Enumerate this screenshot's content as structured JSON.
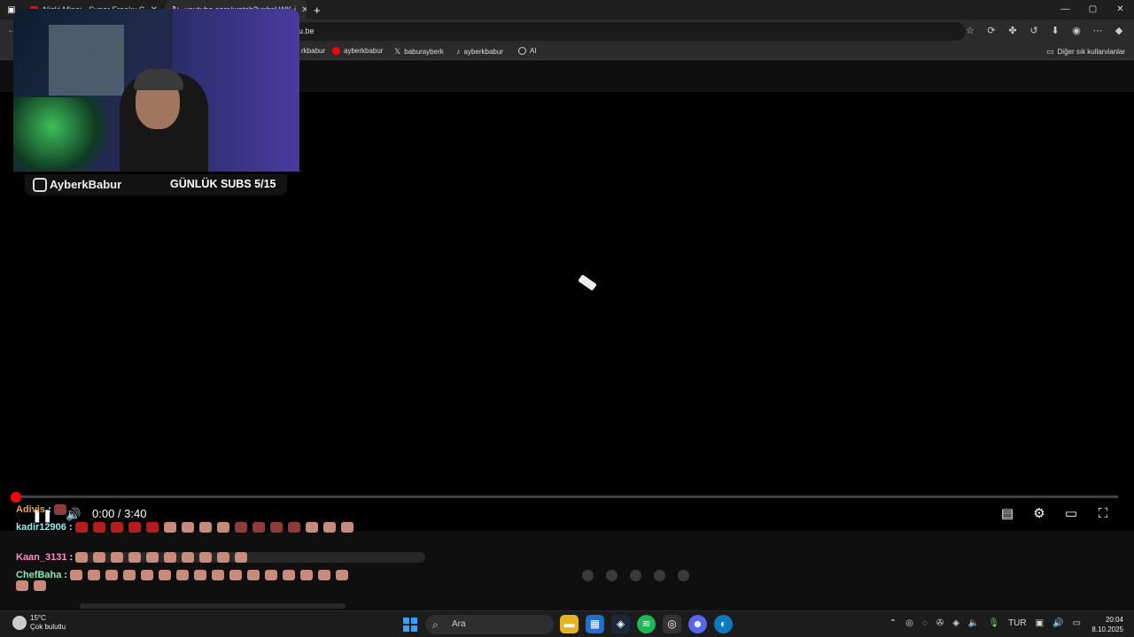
{
  "browser": {
    "tabs": [
      {
        "title": "Nicki Minaj - Super Freaky G",
        "active": false
      },
      {
        "title": "youtube.com/watch?v=bsLWK-i",
        "active": true
      }
    ],
    "new_tab_label": "+",
    "url": "u.be",
    "window_controls": [
      "—",
      "▢",
      "✕"
    ]
  },
  "bookmarks": [
    {
      "label": "rkbabur",
      "icon": "bookmark-icon"
    },
    {
      "label": "ayberkbabur",
      "icon": "youtube-icon"
    },
    {
      "label": "baburayberk",
      "icon": "x-icon"
    },
    {
      "label": "ayberkbabur",
      "icon": "tiktok-icon"
    },
    {
      "label": "AI",
      "icon": "ai-icon"
    }
  ],
  "other_bookmarks": "Diğer sık kullanılanlar",
  "player": {
    "current_time": "0:00",
    "duration": "3:40",
    "time_display": "0:00 / 3:40",
    "progress": 0
  },
  "stream_overlay": {
    "handle": "AyberkBabur",
    "subs_text": "GÜNLÜK SUBS 5/15"
  },
  "chat": [
    {
      "user": "Adivis",
      "color": "#e8a34a",
      "emotes": [
        "hat"
      ]
    },
    {
      "user": "kadir12906",
      "color": "#8ff0f0",
      "emotes": [
        "red",
        "red",
        "red",
        "red",
        "red",
        "pop",
        "pop",
        "pop",
        "pop",
        "hat",
        "hat",
        "hat",
        "hat",
        "pop",
        "pop",
        "pop"
      ]
    },
    {
      "user": "Kaan_3131",
      "color": "#ff8ec2",
      "emotes": [
        "pop",
        "pop",
        "pop",
        "pop",
        "pop",
        "pop",
        "pop",
        "pop",
        "pop",
        "pop"
      ]
    },
    {
      "user": "ChefBaha",
      "color": "#7ef0b0",
      "emotes": [
        "pop",
        "pop",
        "pop",
        "pop",
        "pop",
        "pop",
        "pop",
        "pop",
        "pop",
        "pop",
        "pop",
        "pop",
        "pop",
        "pop",
        "pop",
        "pop",
        "pop",
        "pop"
      ]
    }
  ],
  "taskbar": {
    "weather_temp": "15°C",
    "weather_desc": "Çok bulutlu",
    "search_placeholder": "Ara",
    "language": "TUR",
    "time": "20:04",
    "date": "8.10.2025"
  }
}
